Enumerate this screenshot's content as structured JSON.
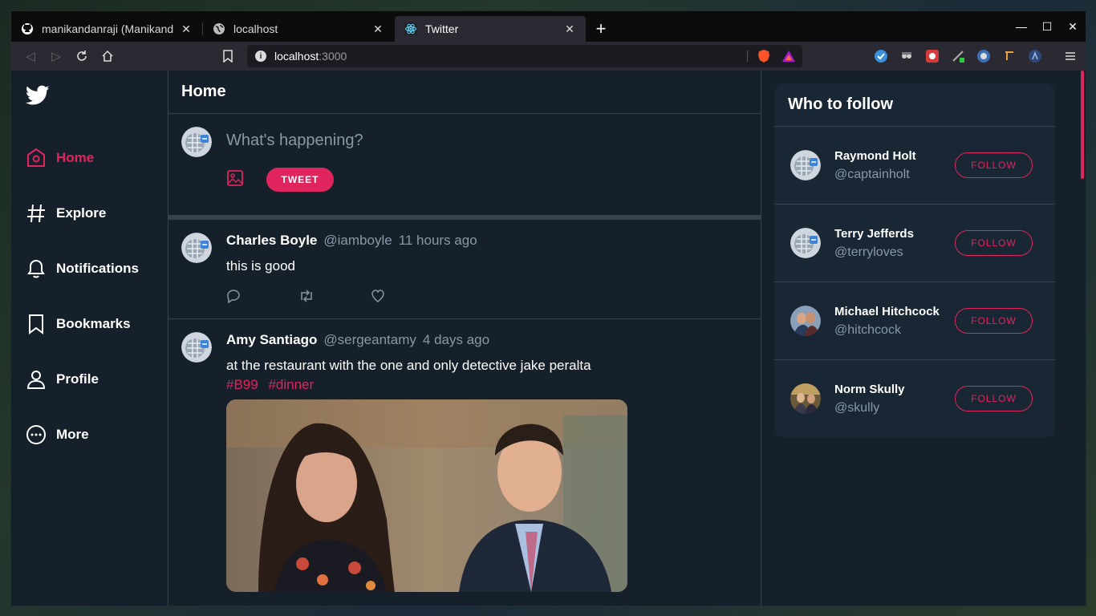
{
  "browser": {
    "tabs": [
      {
        "title": "manikandanraji (Manikand",
        "icon": "github-icon"
      },
      {
        "title": "localhost",
        "icon": "globe-icon"
      },
      {
        "title": "Twitter",
        "icon": "react-icon",
        "active": true
      }
    ],
    "close_glyph": "✕",
    "new_tab_glyph": "+",
    "url_host": "localhost",
    "url_port": ":3000"
  },
  "sidebar": {
    "items": [
      {
        "label": "Home",
        "icon": "home-icon"
      },
      {
        "label": "Explore",
        "icon": "hashtag-icon"
      },
      {
        "label": "Notifications",
        "icon": "bell-icon"
      },
      {
        "label": "Bookmarks",
        "icon": "bookmark-icon"
      },
      {
        "label": "Profile",
        "icon": "user-icon"
      },
      {
        "label": "More",
        "icon": "more-icon"
      }
    ]
  },
  "main": {
    "title": "Home",
    "compose_placeholder": "What's happening?",
    "tweet_button": "TWEET",
    "tweets": [
      {
        "name": "Charles Boyle",
        "handle": "@iamboyle",
        "time": "11 hours ago",
        "text": "this is good",
        "tags": []
      },
      {
        "name": "Amy Santiago",
        "handle": "@sergeantamy",
        "time": "4 days ago",
        "text": "at the restaurant with the one and only detective jake peralta",
        "tags": [
          "#B99",
          "#dinner"
        ]
      }
    ]
  },
  "who_to_follow": {
    "title": "Who to follow",
    "follow_label": "FOLLOW",
    "users": [
      {
        "name": "Raymond Holt",
        "handle": "@captainholt"
      },
      {
        "name": "Terry Jefferds",
        "handle": "@terryloves"
      },
      {
        "name": "Michael Hitchcock",
        "handle": "@hitchcock"
      },
      {
        "name": "Norm Skully",
        "handle": "@skully"
      }
    ]
  },
  "colors": {
    "accent": "#e0245e",
    "background": "#15202b",
    "card": "#192734",
    "border": "#38444d",
    "muted": "#8899a6"
  }
}
